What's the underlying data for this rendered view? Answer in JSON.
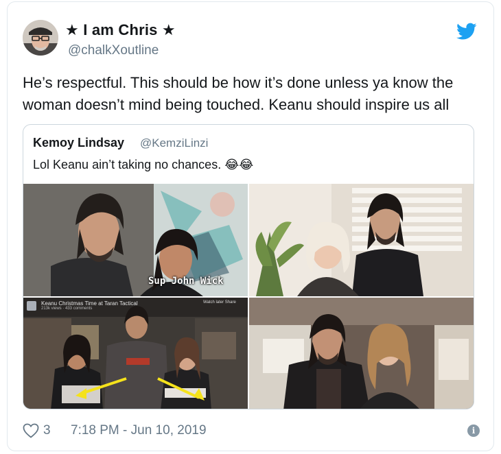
{
  "tweet": {
    "display_name": "★ I am Chris ★",
    "handle": "@chalkXoutline",
    "text": "He’s respectful. This should be how it’s done unless ya know the woman doesn’t mind being touched. Keanu should inspire us all",
    "likes": "3",
    "timestamp": "7:18 PM - Jun 10, 2019",
    "brand_color": "#1da1f2",
    "icons": [
      "twitter-bird-icon",
      "heart-icon",
      "info-icon"
    ]
  },
  "quoted": {
    "display_name": "Kemoy Lindsay",
    "handle": "@KemziLinzi",
    "text": "Lol Keanu ain’t taking no chances. 😂😂",
    "photos": [
      {
        "caption": "Sup John Wick"
      },
      {
        "caption": ""
      },
      {
        "video_title": "Keanu Christmas Time at Taran Tactical",
        "video_meta": "213k views · 433 comments",
        "video_controls": "Watch later   Share"
      },
      {
        "caption": ""
      }
    ]
  }
}
